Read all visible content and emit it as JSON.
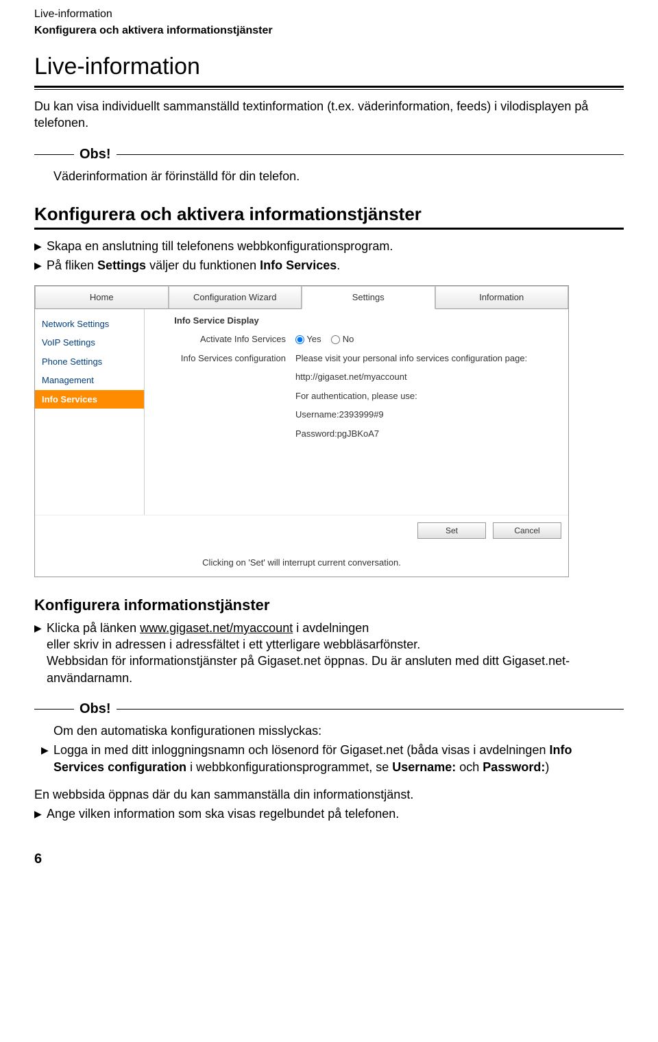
{
  "header": {
    "small": "Live-information",
    "bold": "Konfigurera och aktivera informationstjänster"
  },
  "h1": "Live-information",
  "intro": "Du kan visa individuellt sammanställd textinformation (t.ex. väderinformation, feeds) i vilodisplayen på telefonen.",
  "obs1": {
    "legend": "Obs!",
    "text": "Väderinformation är förinställd för din telefon."
  },
  "h2a": "Konfigurera och aktivera informationstjänster",
  "bullets_a": {
    "b1": "Skapa en anslutning till telefonens webbkonfigurationsprogram.",
    "b2_a": "På fliken ",
    "b2_kw1": "Settings",
    "b2_b": " väljer du funktionen ",
    "b2_kw2": "Info Services",
    "b2_c": "."
  },
  "shot": {
    "tabs": [
      "Home",
      "Configuration Wizard",
      "Settings",
      "Information"
    ],
    "tabs_active": 2,
    "sidebar": [
      "Network Settings",
      "VoIP Settings",
      "Phone Settings",
      "Management",
      "Info Services"
    ],
    "sidebar_active": 4,
    "center": {
      "hd": "Info Service Display",
      "r1": "Activate Info Services",
      "r2": "Info Services configuration"
    },
    "right": {
      "yes": "Yes",
      "no": "No",
      "visit": "Please visit your personal info services configuration page:",
      "url": "http://gigaset.net/myaccount",
      "auth": "For authentication, please use:",
      "user": "Username:2393999#9",
      "pass": "Password:pgJBKoA7"
    },
    "btns": {
      "set": "Set",
      "cancel": "Cancel"
    },
    "foot": "Clicking on 'Set' will interrupt current conversation."
  },
  "h3": "Konfigurera informationstjänster",
  "bullets_b": {
    "b1_a": "Klicka på länken ",
    "b1_link": "www.gigaset.net/myaccount",
    "b1_b": " i avdelningen",
    "b1_c": "eller skriv in adressen i adressfältet i ett ytterligare webbläsarfönster.",
    "b1_d": "Webbsidan för informationstjänster på Gigaset.net öppnas. Du är ansluten med ditt Gigaset.net-användarnamn."
  },
  "obs2": {
    "legend": "Obs!",
    "line1": "Om den automatiska konfigurationen misslyckas:",
    "b_a": "Logga in med ditt inloggningsnamn och lösenord för Gigaset.net (båda visas i avdelningen ",
    "b_kw1": "Info Services configuration",
    "b_b": " i webbkonfigurationsprogrammet, se ",
    "b_kw2": "Username:",
    "b_c": " och ",
    "b_kw3": "Password:",
    "b_d": ")"
  },
  "outro": {
    "p": "En webbsida öppnas där du kan sammanställa din informationstjänst.",
    "b": "Ange vilken information som ska visas regelbundet på telefonen."
  },
  "pagenum": "6"
}
